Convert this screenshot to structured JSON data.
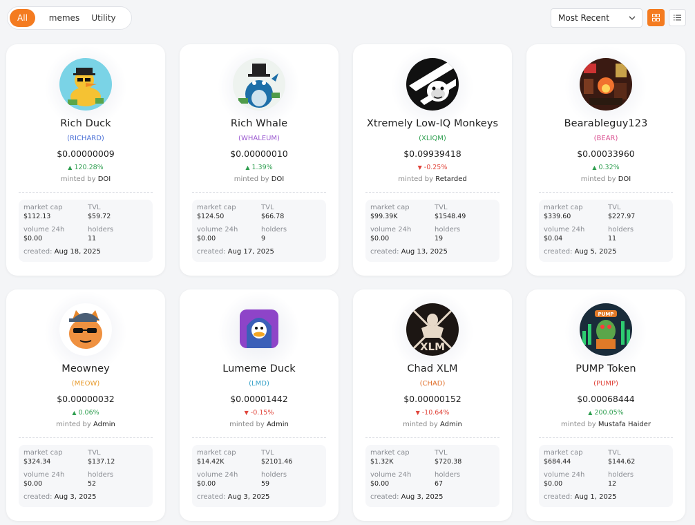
{
  "filters": [
    "All",
    "memes",
    "Utility"
  ],
  "sort": {
    "label": "Most Recent"
  },
  "stat_labels": {
    "market_cap": "market cap",
    "tvl": "TVL",
    "volume": "volume 24h",
    "holders": "holders",
    "created": "created:",
    "minted_by": "minted by"
  },
  "colors": {
    "accent": "#f47b20",
    "up": "#2e9e4f",
    "down": "#e0443a"
  },
  "cards": [
    {
      "name": "Rich Duck",
      "ticker": "(RICHARD)",
      "ticker_color": "#4a6fd6",
      "price": "$0.00000009",
      "change": "120.28%",
      "direction": "up",
      "minted_by": "DOI",
      "market_cap": "$112.13",
      "tvl": "$59.72",
      "volume": "$0.00",
      "holders": "11",
      "created": "Aug 18, 2025",
      "icon": "duck-icon"
    },
    {
      "name": "Rich Whale",
      "ticker": "(WHALEUM)",
      "ticker_color": "#9b59d0",
      "price": "$0.00000010",
      "change": "1.39%",
      "direction": "up",
      "minted_by": "DOI",
      "market_cap": "$124.50",
      "tvl": "$66.78",
      "volume": "$0.00",
      "holders": "9",
      "created": "Aug 17, 2025",
      "icon": "whale-icon"
    },
    {
      "name": "Xtremely Low-IQ Monkeys",
      "ticker": "(XLIQM)",
      "ticker_color": "#2e9e4f",
      "price": "$0.09939418",
      "change": "-0.25%",
      "direction": "down",
      "minted_by": "Retarded",
      "market_cap": "$99.39K",
      "tvl": "$1548.49",
      "volume": "$0.00",
      "holders": "19",
      "created": "Aug 13, 2025",
      "icon": "monkey-icon"
    },
    {
      "name": "Bearableguy123",
      "ticker": "(BEAR)",
      "ticker_color": "#d94e8f",
      "price": "$0.00033960",
      "change": "0.32%",
      "direction": "up",
      "minted_by": "DOI",
      "market_cap": "$339.60",
      "tvl": "$227.97",
      "volume": "$0.04",
      "holders": "11",
      "created": "Aug 5, 2025",
      "icon": "bear-icon"
    },
    {
      "name": "Meowney",
      "ticker": "(MEOW)",
      "ticker_color": "#e79a2c",
      "price": "$0.00000032",
      "change": "0.06%",
      "direction": "up",
      "minted_by": "Admin",
      "market_cap": "$324.34",
      "tvl": "$137.12",
      "volume": "$0.00",
      "holders": "52",
      "created": "Aug 3, 2025",
      "icon": "cat-icon"
    },
    {
      "name": "Lumeme Duck",
      "ticker": "(LMD)",
      "ticker_color": "#3aa3c9",
      "price": "$0.00001442",
      "change": "-0.15%",
      "direction": "down",
      "minted_by": "Admin",
      "market_cap": "$14.42K",
      "tvl": "$2101.46",
      "volume": "$0.00",
      "holders": "59",
      "created": "Aug 3, 2025",
      "icon": "hooded-duck-icon"
    },
    {
      "name": "Chad XLM",
      "ticker": "(CHAD)",
      "ticker_color": "#e0702c",
      "price": "$0.00000152",
      "change": "-10.64%",
      "direction": "down",
      "minted_by": "Admin",
      "market_cap": "$1.32K",
      "tvl": "$720.38",
      "volume": "$0.00",
      "holders": "67",
      "created": "Aug 3, 2025",
      "icon": "chad-icon"
    },
    {
      "name": "PUMP Token",
      "ticker": "(PUMP)",
      "ticker_color": "#e0443a",
      "price": "$0.00068444",
      "change": "200.05%",
      "direction": "up",
      "minted_by": "Mustafa Haider",
      "market_cap": "$684.44",
      "tvl": "$144.62",
      "volume": "$0.00",
      "holders": "12",
      "created": "Aug 1, 2025",
      "icon": "pump-icon"
    }
  ]
}
